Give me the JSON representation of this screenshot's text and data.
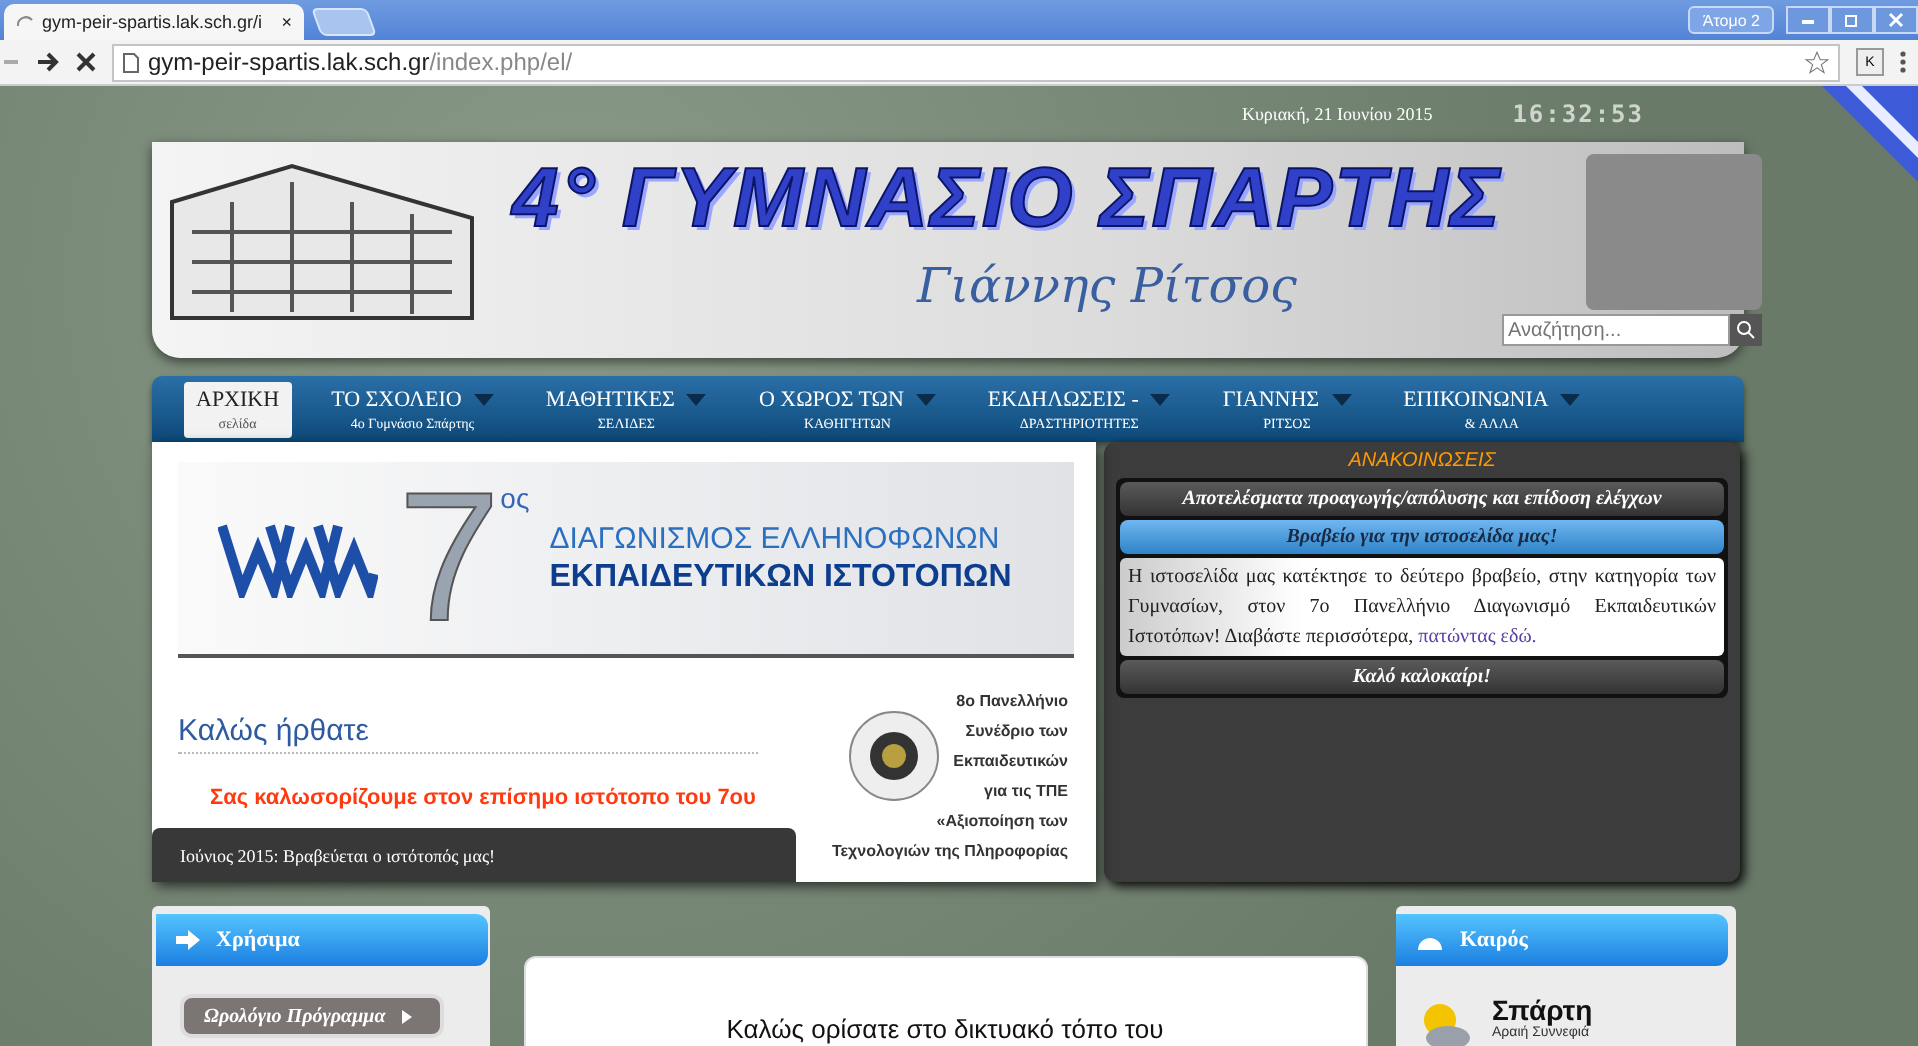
{
  "browser": {
    "tab_title": "gym-peir-spartis.lak.sch.gr/i",
    "tab_close": "×",
    "profile": "Άτομο 2",
    "url_host": "gym-peir-spartis.lak.sch.gr",
    "url_path": "/index.php/el/",
    "extension": "K"
  },
  "header": {
    "date": "Κυριακή, 21 Ιουνίου 2015",
    "clock": "16:32:53",
    "title": "4° ΓΥΜΝΑΣΙΟ ΣΠΑΡΤΗΣ",
    "signature": "Γιάννης Ρίτσος",
    "search": {
      "placeholder": "Αναζήτηση..."
    }
  },
  "nav": [
    {
      "label": "ΑΡΧΙΚΗ",
      "sub": "σελίδα",
      "selected": true,
      "has_menu": false
    },
    {
      "label": "ΤΟ ΣΧΟΛΕΙΟ",
      "sub": "4ο Γυμνάσιο Σπάρτης",
      "selected": false,
      "has_menu": true
    },
    {
      "label": "ΜΑΘΗΤΙΚΕΣ",
      "sub": "ΣΕΛΙΔΕΣ",
      "selected": false,
      "has_menu": true
    },
    {
      "label": "Ο ΧΩΡΟΣ ΤΩΝ",
      "sub": "ΚΑΘΗΓΗΤΩΝ",
      "selected": false,
      "has_menu": true
    },
    {
      "label": "ΕΚΔΗΛΩΣΕΙΣ -",
      "sub": "ΔΡΑΣΤΗΡΙΟΤΗΤΕΣ",
      "selected": false,
      "has_menu": true
    },
    {
      "label": "ΓΙΑΝΝΗΣ",
      "sub": "ΡΙΤΣΟΣ",
      "selected": false,
      "has_menu": true
    },
    {
      "label": "ΕΠΙΚΟΙΝΩΝΙΑ",
      "sub": "& ΑΛΛΑ",
      "selected": false,
      "has_menu": true
    }
  ],
  "slideshow": {
    "banner": {
      "number": "7",
      "suffix": "ος",
      "line_1": "ΔΙΑΓΩΝΙΣΜΟΣ ΕΛΛΗΝΟΦΩΝΩΝ",
      "line_2": "ΕΚΠΑΙΔΕΥΤΙΚΩΝ ΙΣΤΟΤΟΠΩΝ"
    },
    "heading": "Καλώς ήρθατε",
    "intro": "Σας καλωσορίζουμε στον επίσημο ιστότοπο του 7ου",
    "side_lines": [
      "8ο Πανελλήνιο",
      "Συνέδριο των",
      "Εκπαιδευτικών",
      "για τις ΤΠΕ",
      "«Αξιοποίηση των",
      "Τεχνολογιών της Πληροφορίας"
    ],
    "caption": "Ιούνιος 2015: Βραβεύεται ο ιστότοπός μας!"
  },
  "announcements": {
    "title": "ΑΝΑΚΟΙΝΩΣΕΙΣ",
    "items": [
      {
        "kind": "header",
        "title": "Αποτελέσματα προαγωγής/απόλυσης και επίδοση ελέγχων",
        "expanded": false
      },
      {
        "kind": "header",
        "title": "Βραβείο για την ιστοσελίδα μας!",
        "expanded": true,
        "body": "Η ιστοσελίδα μας κατέκτησε το δεύτερο βραβείο, στην κατηγορία των Γυμνασίων, στον 7ο Πανελλήνιο Διαγωνισμό Εκπαιδευτικών Ιστοτόπων! Διαβάστε περισσότερα, ",
        "link": "πατώντας εδώ."
      },
      {
        "kind": "header",
        "title": "Καλό καλοκαίρι!",
        "expanded": false
      }
    ]
  },
  "useful": {
    "title": "Χρήσιμα",
    "items": [
      "Ωρολόγιο Πρόγραμμα"
    ]
  },
  "welcome_card": {
    "text": "Καλώς ορίσατε στο δικτυακό τόπο του"
  },
  "weather": {
    "title": "Καιρός",
    "city": "Σπάρτη",
    "condition": "Αραιή Συννεφιά"
  }
}
